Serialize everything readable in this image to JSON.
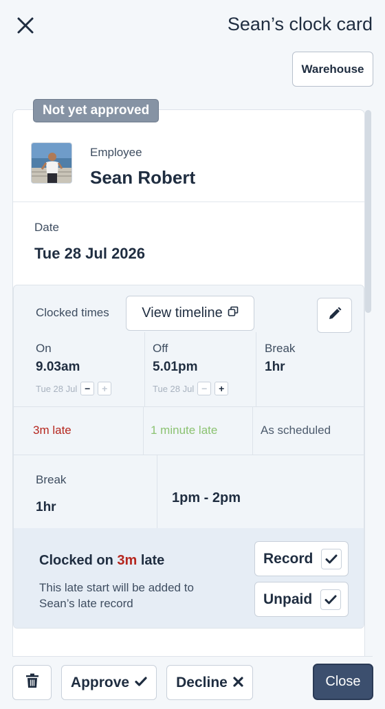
{
  "header": {
    "title": "Sean’s clock card",
    "location_button": "Warehouse"
  },
  "status_badge": "Not yet approved",
  "employee": {
    "label": "Employee",
    "name": "Sean Robert"
  },
  "date": {
    "label": "Date",
    "value": "Tue 28 Jul 2026"
  },
  "clocked_times": {
    "label": "Clocked times",
    "view_timeline_label": "View timeline",
    "on": {
      "label": "On",
      "time": "9.03am",
      "date": "Tue 28 Jul",
      "status": "3m late"
    },
    "off": {
      "label": "Off",
      "time": "5.01pm",
      "date": "Tue 28 Jul",
      "status": "1 minute late"
    },
    "break": {
      "label": "Break",
      "value": "1hr",
      "status": "As scheduled"
    },
    "stepper": {
      "minus": "−",
      "plus": "+"
    }
  },
  "break_detail": {
    "label": "Break",
    "value": "1hr",
    "range": "1pm - 2pm"
  },
  "late_notice": {
    "title_prefix": "Clocked on",
    "late_amount": "3m",
    "title_suffix": "late",
    "description": "This late start will be added to Sean’s late record",
    "record_label": "Record",
    "unpaid_label": "Unpaid"
  },
  "footer": {
    "approve_label": "Approve",
    "decline_label": "Decline",
    "close_label": "Close"
  },
  "colors": {
    "late_red": "#b5261e",
    "late_green": "#8bc271",
    "badge_grey": "#8693a4",
    "close_button": "#3c4f6e"
  }
}
